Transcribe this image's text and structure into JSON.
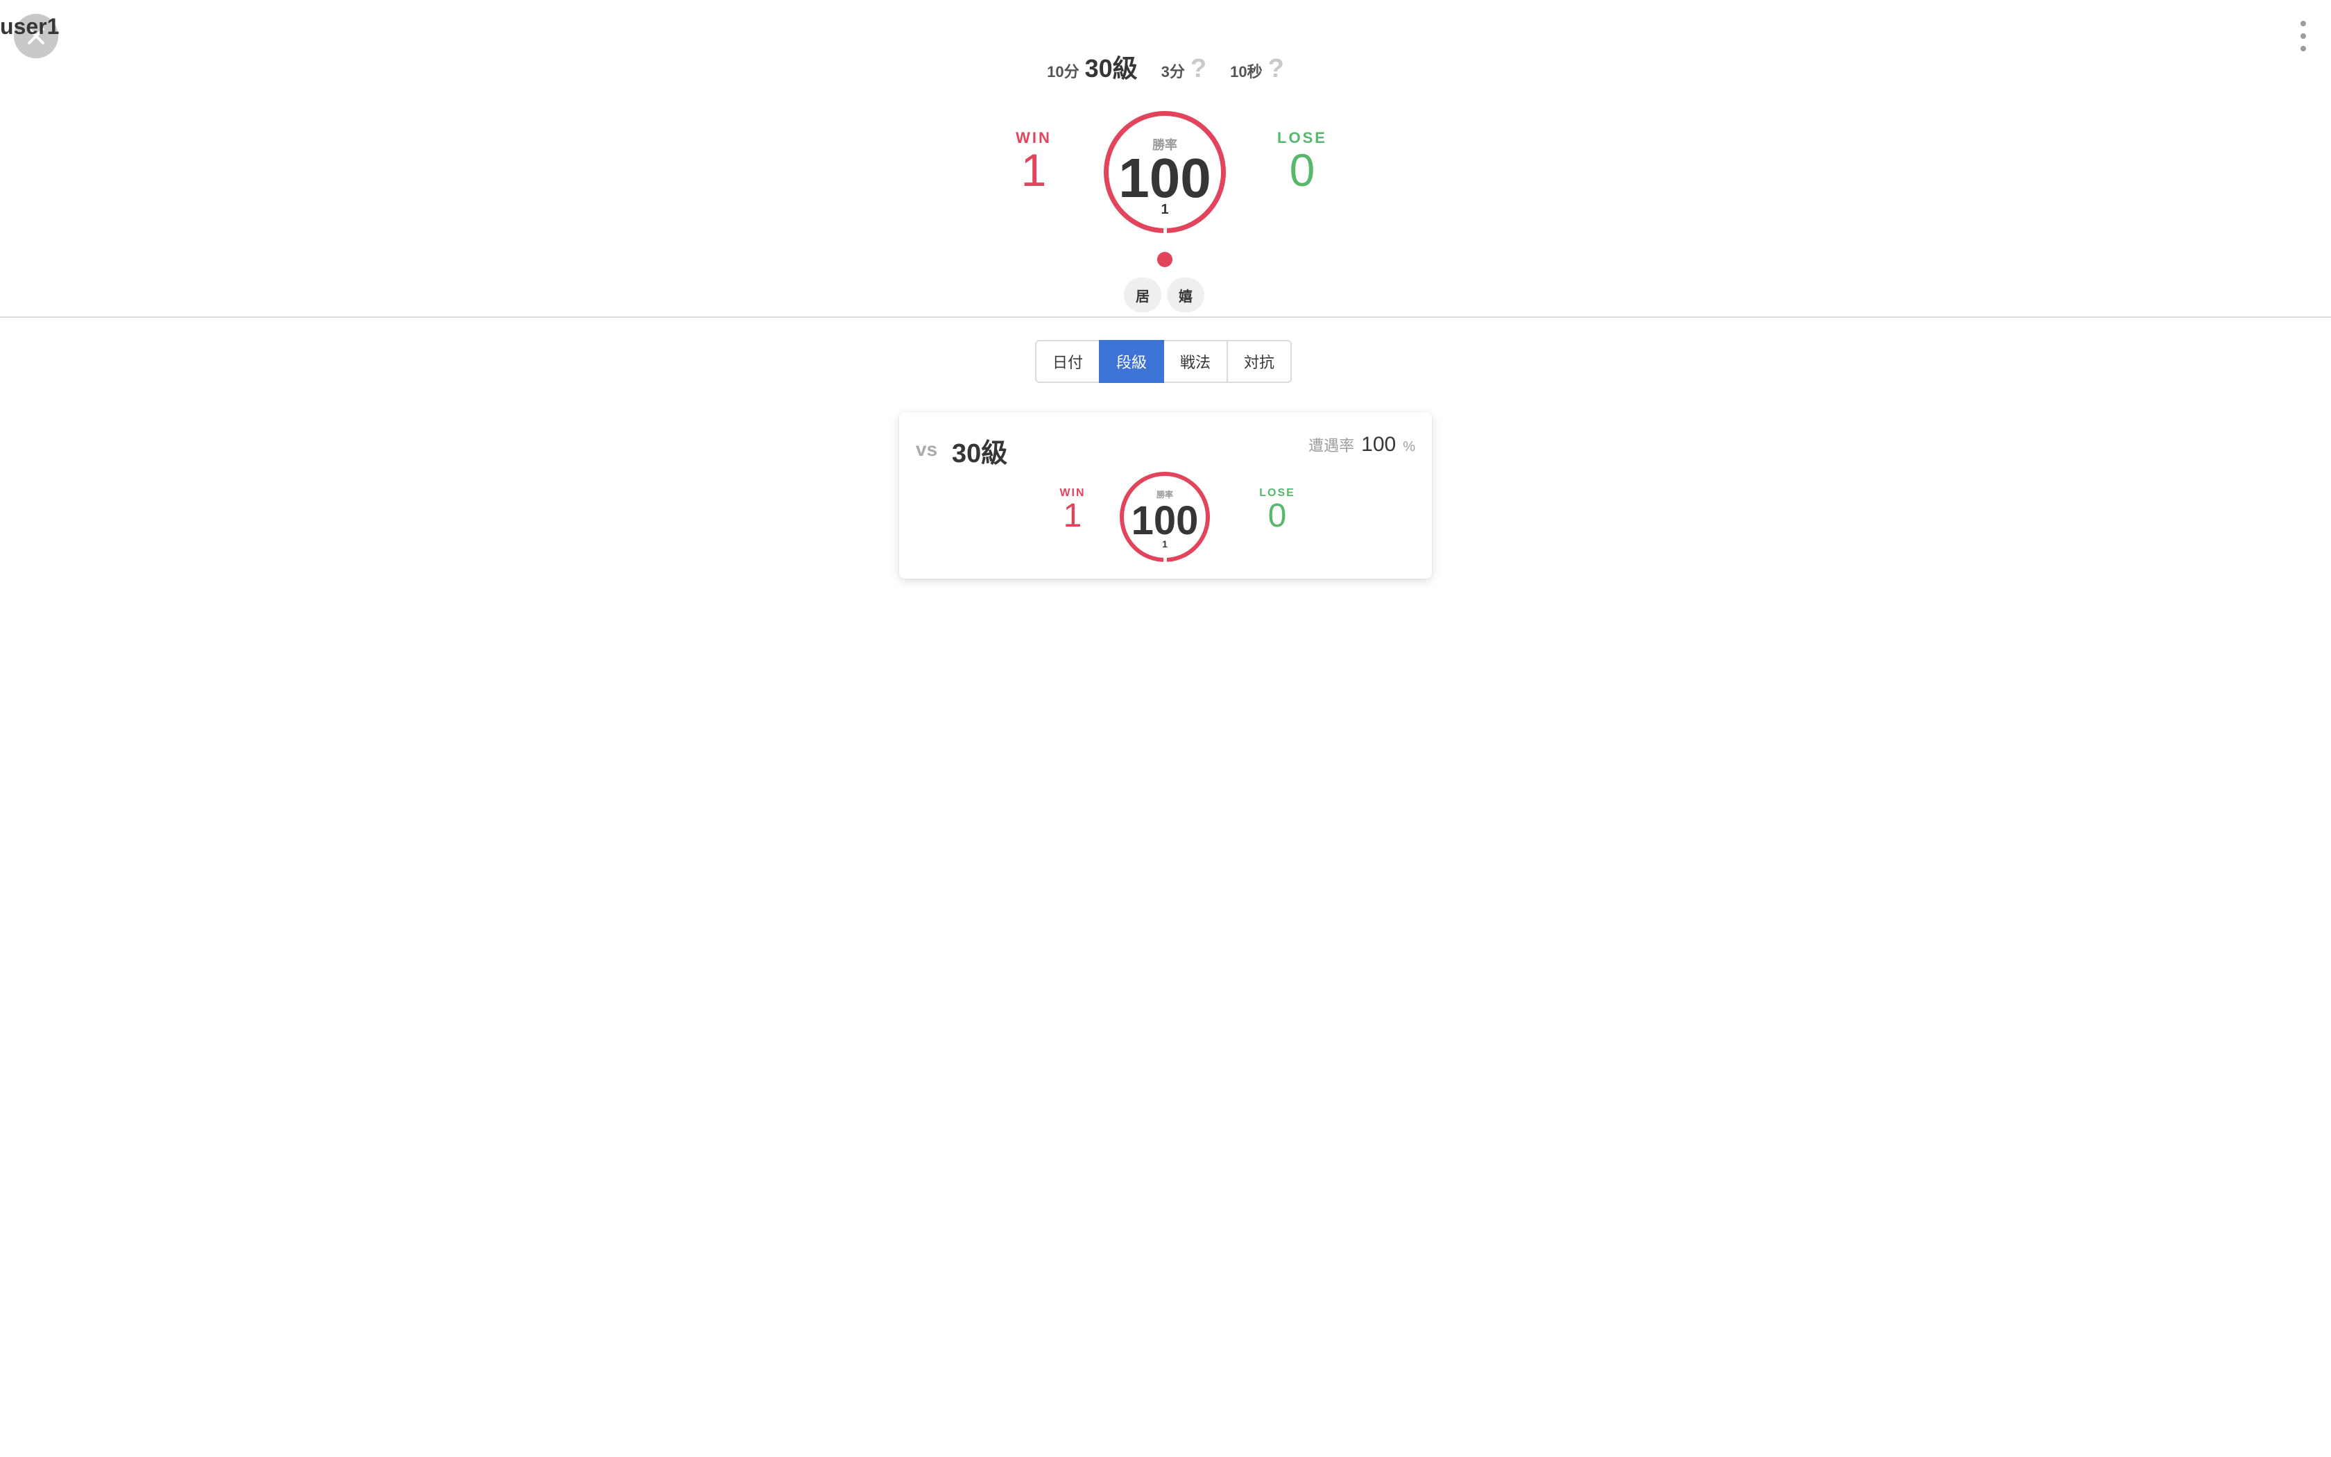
{
  "header": {
    "user_name": "user1",
    "rules": [
      {
        "label": "10分",
        "value": "30級"
      },
      {
        "label": "3分",
        "value": "?"
      },
      {
        "label": "10秒",
        "value": "?"
      }
    ]
  },
  "summary": {
    "win_label": "WIN",
    "win_count": "1",
    "lose_label": "LOSE",
    "lose_count": "0",
    "ring_caption": "勝率",
    "ring_value": "100",
    "ring_sub": "1",
    "results": [
      "win"
    ],
    "tags": [
      "居",
      "嬉"
    ]
  },
  "tabs": [
    {
      "label": "日付",
      "active": false
    },
    {
      "label": "段級",
      "active": true
    },
    {
      "label": "戦法",
      "active": false
    },
    {
      "label": "対抗",
      "active": false
    }
  ],
  "card": {
    "vs_label": "vs",
    "opponent_rank": "30級",
    "encounter_label": "遭遇率",
    "encounter_value": "100",
    "encounter_unit": "%",
    "win_label": "WIN",
    "win_count": "1",
    "lose_label": "LOSE",
    "lose_count": "0",
    "ring_caption": "勝率",
    "ring_value": "100",
    "ring_sub": "1"
  },
  "colors": {
    "win": "#e2445c",
    "lose": "#56b86a",
    "active_tab": "#3e73d6"
  },
  "icons": {
    "close": "close-icon",
    "menu": "more-vertical-icon"
  }
}
